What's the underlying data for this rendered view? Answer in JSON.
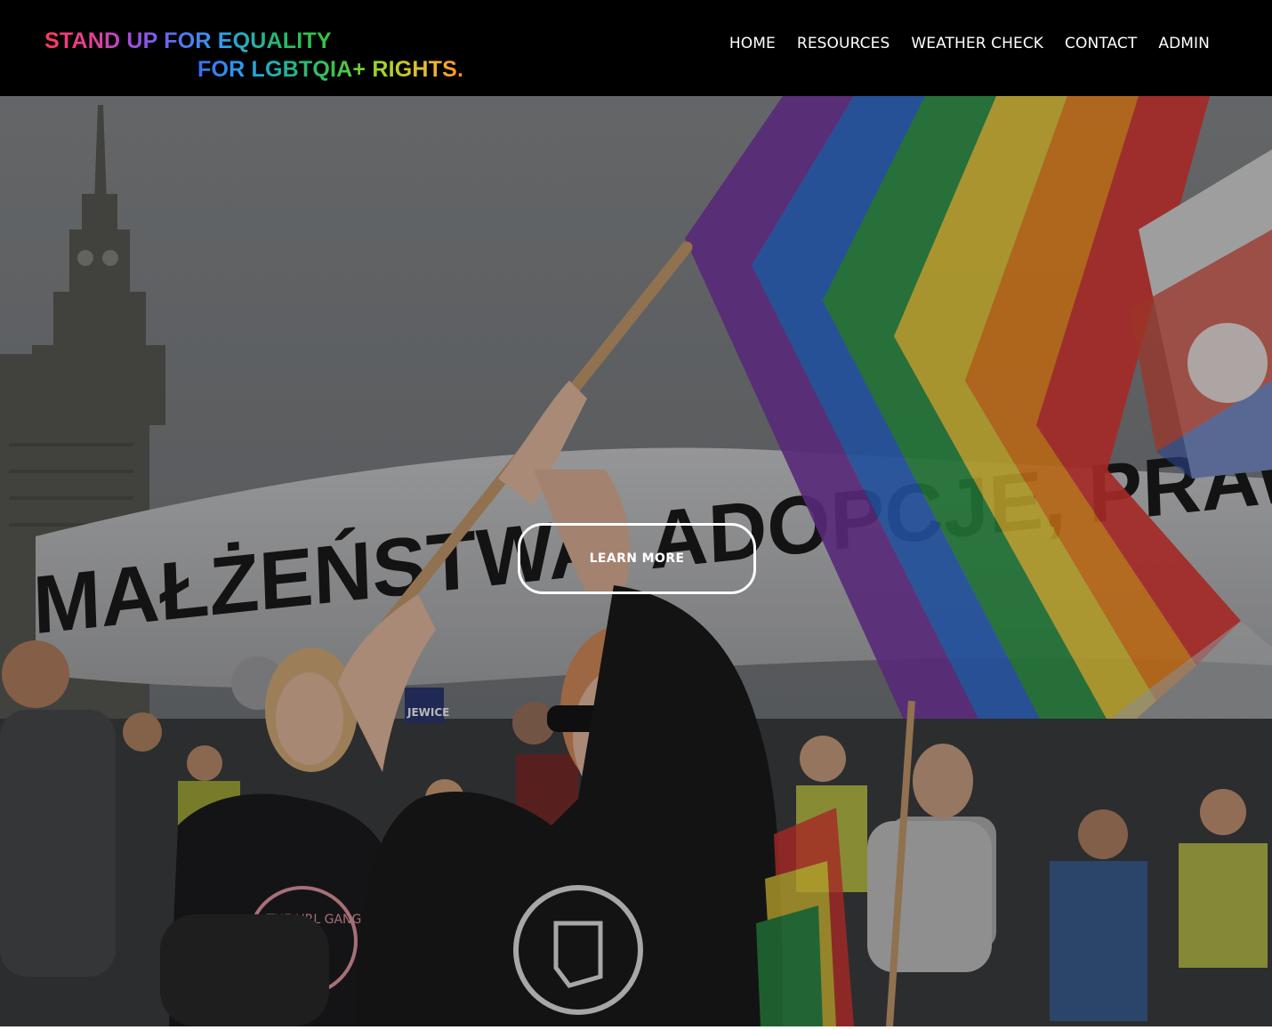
{
  "logo": {
    "line1": "STAND UP FOR EQUALITY",
    "line2": "FOR LGBTQIA+ RIGHTS."
  },
  "nav": {
    "items": [
      "HOME",
      "RESOURCES",
      "WEATHER CHECK",
      "CONTACT",
      "ADMIN"
    ]
  },
  "hero": {
    "banner_text": "MAŁŻEŃSTWA, ADOPCJE, PRAWA LGBT",
    "cta_label": "LEARN MORE",
    "sign_text": "JEWICE",
    "shirt_text": "THE URL GANG"
  },
  "colors": {
    "header_bg": "#000000",
    "nav_text": "#ffffff",
    "cta_border": "#ffffff",
    "flag_stripes": [
      "#e53935",
      "#ff8f1f",
      "#f5d63a",
      "#2e9e4a",
      "#2f6fd8",
      "#7a3aa8"
    ]
  }
}
